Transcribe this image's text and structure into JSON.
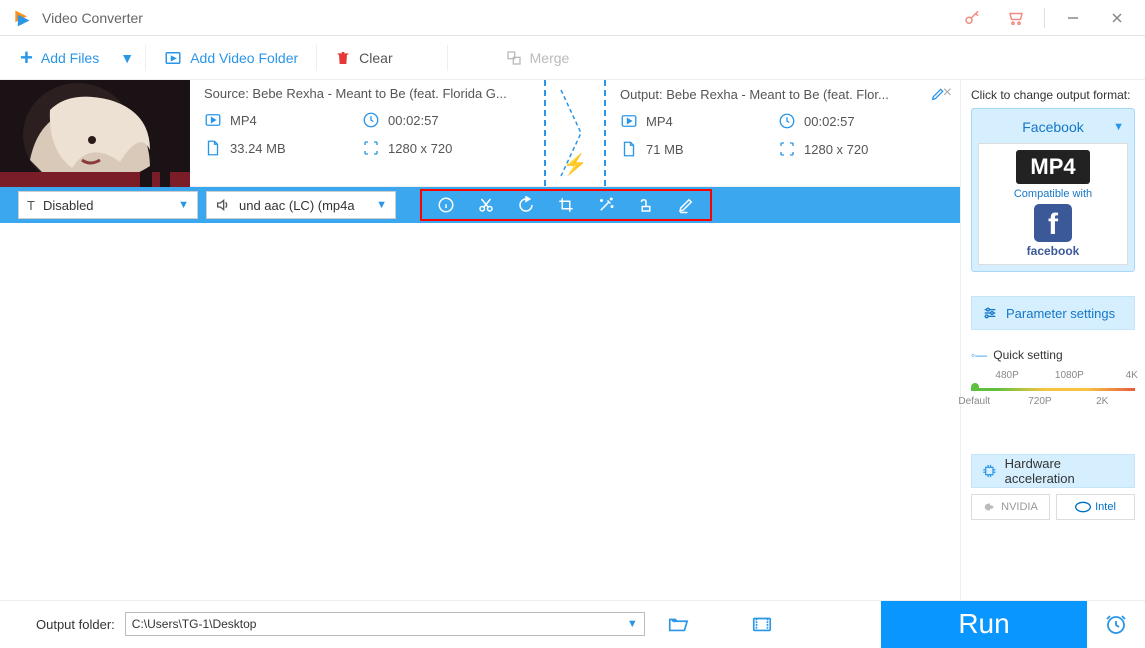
{
  "app": {
    "title": "Video Converter"
  },
  "toolbar": {
    "add_files": "Add Files",
    "add_folder": "Add Video Folder",
    "clear": "Clear",
    "merge": "Merge"
  },
  "item": {
    "source_label": "Source: Bebe Rexha - Meant to Be (feat. Florida G...",
    "output_label": "Output: Bebe Rexha - Meant to Be (feat. Flor...",
    "src": {
      "format": "MP4",
      "duration": "00:02:57",
      "size": "33.24 MB",
      "resolution": "1280 x 720"
    },
    "out": {
      "format": "MP4",
      "duration": "00:02:57",
      "size": "71 MB",
      "resolution": "1280 x 720"
    }
  },
  "editbar": {
    "subtitle": "Disabled",
    "audio": "und aac (LC) (mp4a"
  },
  "rpanel": {
    "hint": "Click to change output format:",
    "format_name": "Facebook",
    "badge": "MP4",
    "compat": "Compatible with",
    "fb_text": "facebook",
    "params": "Parameter settings",
    "quick": "Quick setting",
    "ticks_top": [
      "480P",
      "1080P",
      "4K"
    ],
    "ticks_bottom": [
      "Default",
      "720P",
      "2K"
    ],
    "hwaccel": "Hardware acceleration",
    "nvidia": "NVIDIA",
    "intel": "Intel"
  },
  "bottom": {
    "label": "Output folder:",
    "path": "C:\\Users\\TG-1\\Desktop",
    "run": "Run"
  }
}
